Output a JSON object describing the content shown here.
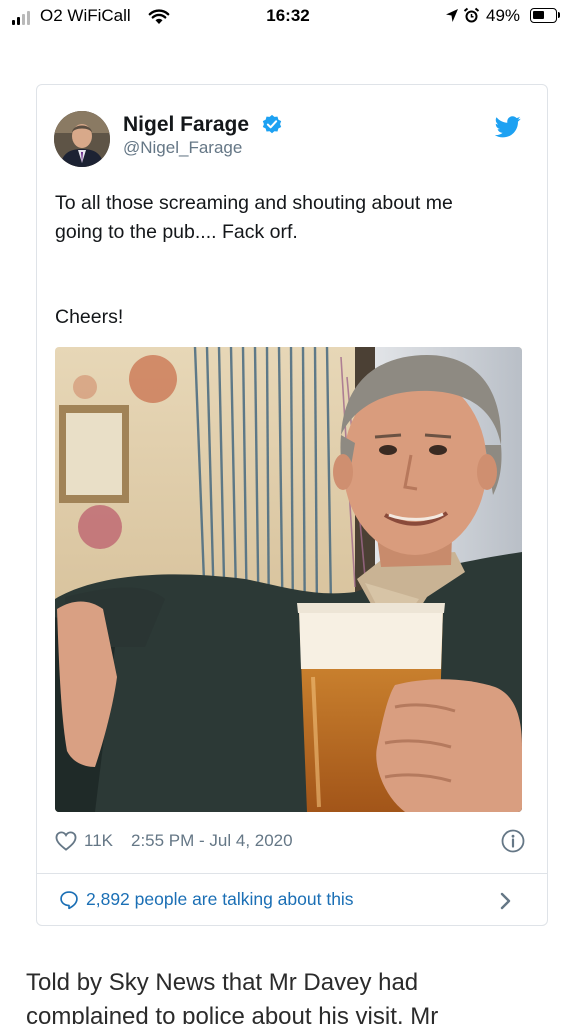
{
  "status_bar": {
    "carrier": "O2 WiFiCall",
    "time": "16:32",
    "battery": "49%"
  },
  "tweet": {
    "display_name": "Nigel Farage",
    "handle": "@Nigel_Farage",
    "text": "To all those screaming and shouting about me going to the pub.... Fack orf.",
    "text_line1": "To all those screaming and shouting about me",
    "text_line2": "going to the pub.... Fack orf.",
    "cheers": "Cheers!",
    "likes": "11K",
    "timestamp": "2:55 PM - Jul 4, 2020",
    "talking": "2,892 people are talking about this"
  },
  "article": {
    "line1": "Told by Sky News that Mr Davey had",
    "line2": "complained to police about his visit, Mr"
  },
  "colors": {
    "twitter_blue": "#1da1f2",
    "link_blue": "#1b6fb5",
    "meta_grey": "#657786",
    "border": "#dfe3e8"
  },
  "icons": [
    "signal-icon",
    "wifi-icon",
    "location-arrow-icon",
    "alarm-icon",
    "battery-icon",
    "verified-badge-icon",
    "twitter-bird-icon",
    "heart-icon",
    "info-icon",
    "comment-icon",
    "chevron-right-icon"
  ]
}
